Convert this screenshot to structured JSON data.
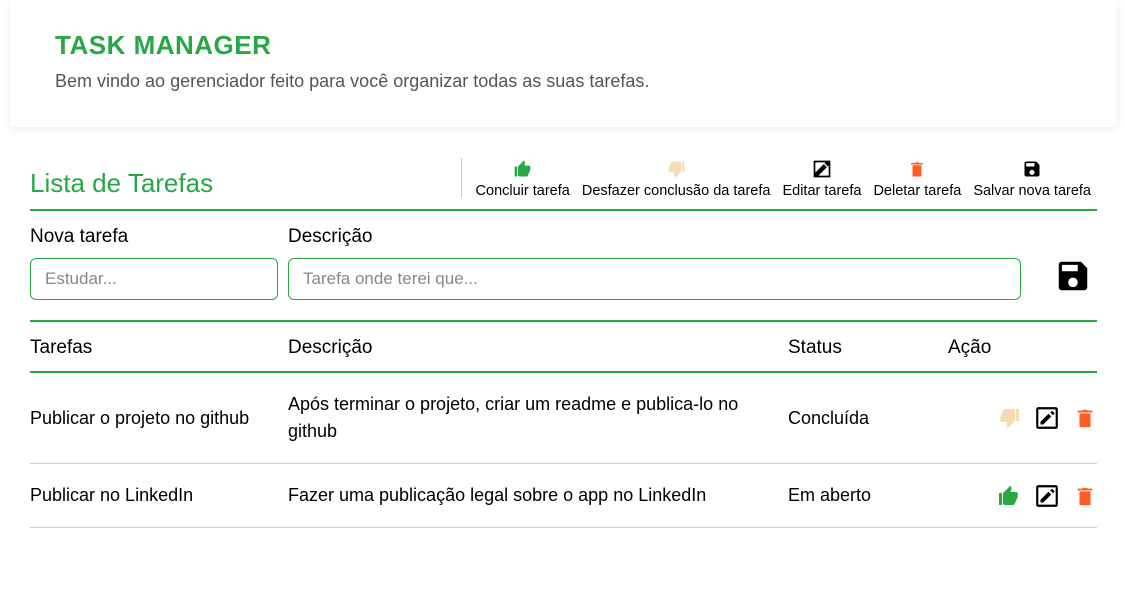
{
  "header": {
    "title": "TASK MANAGER",
    "subtitle": "Bem vindo ao gerenciador feito para você organizar todas as suas tarefas."
  },
  "list": {
    "title": "Lista de Tarefas"
  },
  "legend": {
    "complete": "Concluir tarefa",
    "undo": "Desfazer conclusão da tarefa",
    "edit": "Editar tarefa",
    "delete": "Deletar tarefa",
    "save": "Salvar nova tarefa"
  },
  "form": {
    "new_task_label": "Nova tarefa",
    "new_task_placeholder": "Estudar...",
    "description_label": "Descrição",
    "description_placeholder": "Tarefa onde terei que..."
  },
  "table": {
    "headers": {
      "task": "Tarefas",
      "description": "Descrição",
      "status": "Status",
      "action": "Ação"
    },
    "rows": [
      {
        "task": "Publicar o projeto no github",
        "description": "Após terminar o projeto, criar um readme e publica-lo no github",
        "status": "Concluída",
        "completed": true
      },
      {
        "task": "Publicar no LinkedIn",
        "description": "Fazer uma publicação legal sobre o app no LinkedIn",
        "status": "Em aberto",
        "completed": false
      }
    ]
  },
  "colors": {
    "accent": "#28a745",
    "thumbs_up": "#28a745",
    "thumbs_down": "#f5dcb4",
    "delete": "#ff5b24",
    "edit": "#000000",
    "save": "#000000"
  }
}
